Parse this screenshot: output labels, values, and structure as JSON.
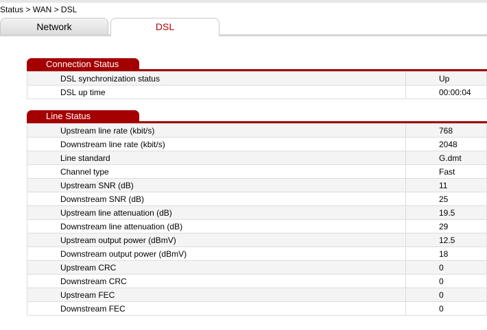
{
  "breadcrumb": "Status > WAN > DSL",
  "tabs": [
    {
      "label": "Network"
    },
    {
      "label": "DSL"
    }
  ],
  "colors": {
    "accent": "#a40000",
    "active_tab_text": "#b30000"
  },
  "connection_status": {
    "title": "Connection Status",
    "rows": [
      {
        "label": "DSL synchronization status",
        "value": "Up"
      },
      {
        "label": "DSL up time",
        "value": "00:00:04"
      }
    ]
  },
  "line_status": {
    "title": "Line Status",
    "rows": [
      {
        "label": "Upstream line rate (kbit/s)",
        "value": "768"
      },
      {
        "label": "Downstream line rate (kbit/s)",
        "value": "2048"
      },
      {
        "label": "Line standard",
        "value": "G.dmt"
      },
      {
        "label": "Channel type",
        "value": "Fast"
      },
      {
        "label": "Upstream SNR (dB)",
        "value": "11"
      },
      {
        "label": "Downstream SNR (dB)",
        "value": "25"
      },
      {
        "label": "Upstream line attenuation (dB)",
        "value": "19.5"
      },
      {
        "label": "Downstream line attenuation (dB)",
        "value": "29"
      },
      {
        "label": "Upstream output power (dBmV)",
        "value": "12.5"
      },
      {
        "label": "Downstream output power (dBmV)",
        "value": "18"
      },
      {
        "label": "Upstream CRC",
        "value": "0"
      },
      {
        "label": "Downstream CRC",
        "value": "0"
      },
      {
        "label": "Upstream FEC",
        "value": "0"
      },
      {
        "label": "Downstream FEC",
        "value": "0"
      }
    ]
  }
}
